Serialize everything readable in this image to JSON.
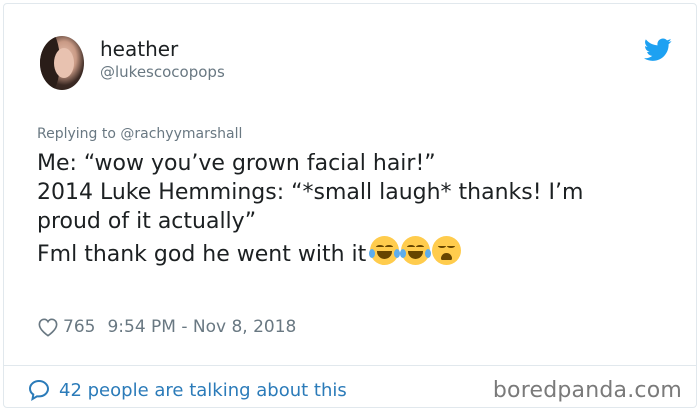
{
  "user": {
    "name": "heather",
    "handle": "@lukescocopops"
  },
  "tweet": {
    "replying_to": "Replying to @rachyymarshall",
    "lines": [
      "Me: “wow you’ve grown facial hair!”",
      "2014 Luke Hemmings: “*small laugh* thanks! I’m",
      "proud of it actually”"
    ],
    "last_line": "Fml thank god he went with it",
    "emojis": [
      "face-with-tears-of-joy-icon",
      "face-with-tears-of-joy-icon",
      "weary-face-icon"
    ]
  },
  "meta": {
    "likes": "765",
    "timestamp": "9:54 PM - Nov 8, 2018"
  },
  "footer": {
    "talking": "42 people are talking about this",
    "watermark": "boredpanda.com"
  },
  "colors": {
    "twitter_blue": "#1da1f2",
    "link_blue": "#2b7bb9",
    "muted": "#697882",
    "emoji_yellow": "#ffcc4d"
  }
}
